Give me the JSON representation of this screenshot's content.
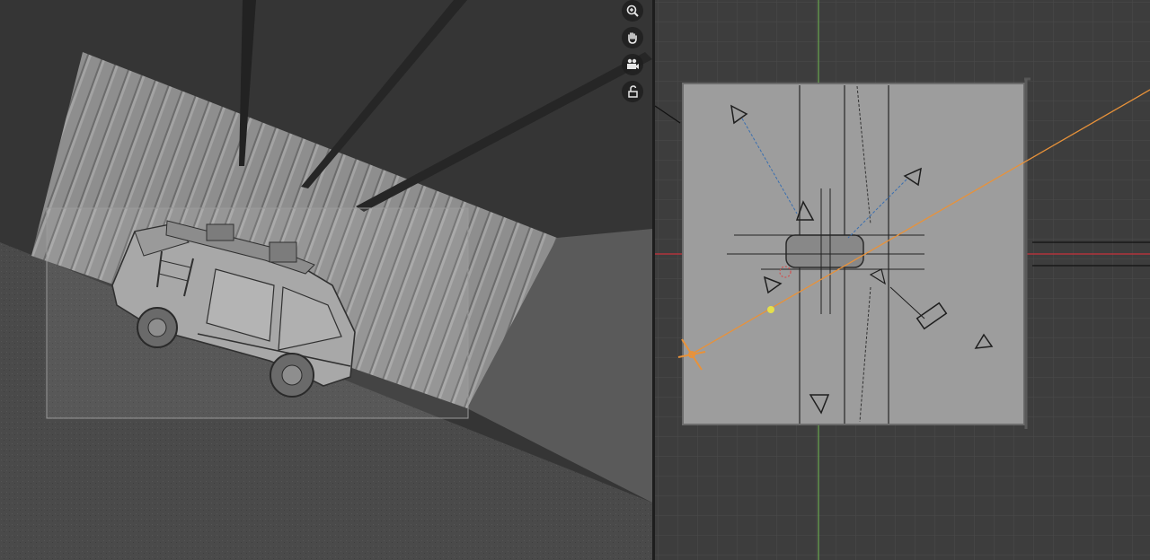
{
  "left_viewport": {
    "view": "camera-perspective",
    "shading": "solid",
    "object": "van"
  },
  "right_viewport": {
    "view": "top-orthographic",
    "shading": "solid",
    "axis_colors": {
      "x_axis": "#c8323c",
      "y_axis": "#6aa84f"
    },
    "selection_color": "#e8923a",
    "light_color": "#e5e04a"
  },
  "navigation_gizmo": {
    "buttons": [
      "zoom-icon",
      "hand-pan-icon",
      "camera-view-icon",
      "lock-icon"
    ]
  }
}
